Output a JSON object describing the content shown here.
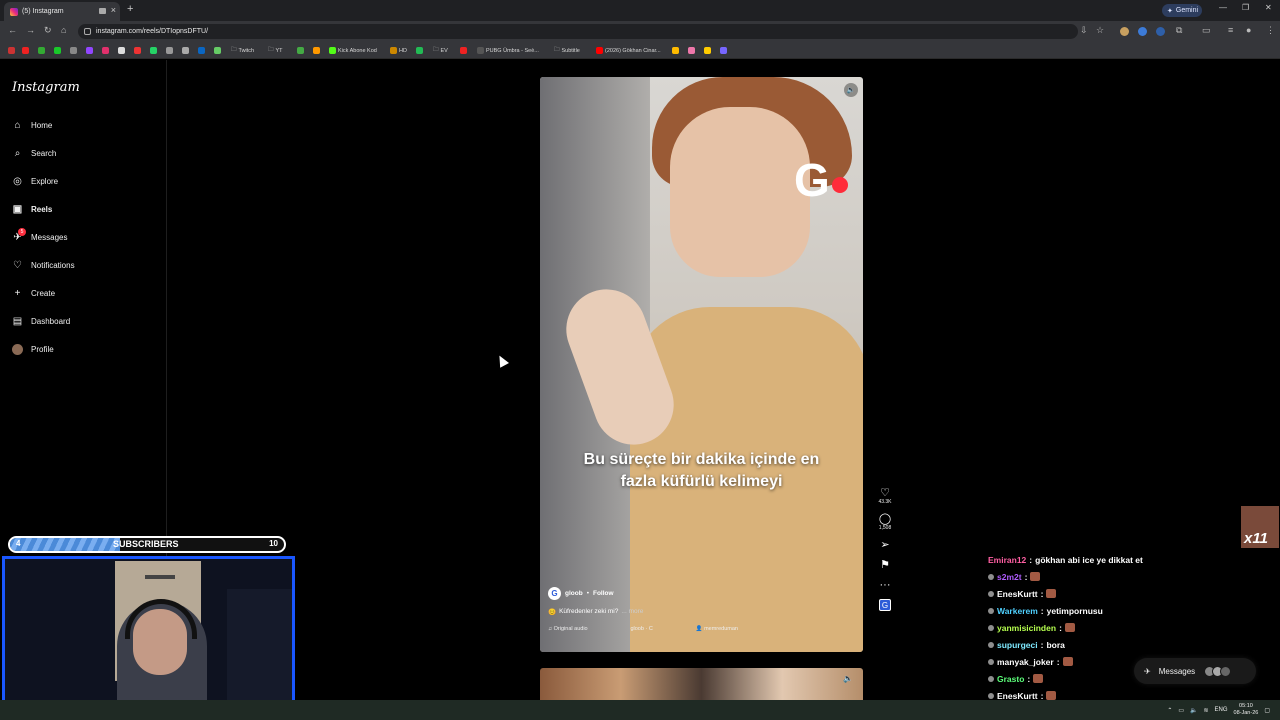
{
  "browser": {
    "tab_title": "(5) Instagram",
    "new_tab": "+",
    "gemini_label": "Gemini",
    "url": "instagram.com/reels/DTIopnsDFTU/",
    "bookmarks": [
      "Twitch",
      "YT",
      "Kick Abone Kod",
      "HD",
      "EV",
      "PUBG Ümbra - Seè...",
      "Subtitle",
      "(2026) Gökhan Cinar..."
    ]
  },
  "instagram": {
    "logo": "Instagram",
    "nav": [
      {
        "label": "Home",
        "icon": "home-icon"
      },
      {
        "label": "Search",
        "icon": "search-icon"
      },
      {
        "label": "Explore",
        "icon": "compass-icon"
      },
      {
        "label": "Reels",
        "icon": "reels-icon",
        "active": true
      },
      {
        "label": "Messages",
        "icon": "messenger-icon",
        "badge": "5"
      },
      {
        "label": "Notifications",
        "icon": "heart-icon"
      },
      {
        "label": "Create",
        "icon": "plus-icon"
      },
      {
        "label": "Dashboard",
        "icon": "dashboard-icon"
      },
      {
        "label": "Profile",
        "icon": "avatar-icon"
      }
    ],
    "reel": {
      "brand_letter": "G",
      "caption_line1": "Bu süreçte bir dakika içinde en",
      "caption_line2": "fazla küfürlü kelimeyi",
      "author": "gloob",
      "follow": "Follow",
      "description": "Küfredenler zeki mi?",
      "more": "... more",
      "audio": "Original audio",
      "audio_source": "gloob · C",
      "tagged_user": "memreduman"
    },
    "actions": {
      "likes": "43.3K",
      "comments": "1,508"
    },
    "messages_label": "Messages"
  },
  "stream": {
    "subs_current": "4",
    "subs_label": "SUBSCRIBERS",
    "subs_goal": "10",
    "subs_progress": 0.4,
    "alert_text": "x11",
    "chat": [
      {
        "user": "Emiran12",
        "color": "#ff5fa3",
        "msg": "gökhan abi ice ye dikkat et",
        "emote": false
      },
      {
        "user": "s2m2t",
        "color": "#b05cff",
        "msg": "",
        "emote": true
      },
      {
        "user": "EnesKurtt",
        "color": "#ffffff",
        "msg": "",
        "emote": true
      },
      {
        "user": "Warkerem",
        "color": "#4fd1ff",
        "msg": "yetimpornusu",
        "emote": false
      },
      {
        "user": "yanmisicinden",
        "color": "#b6ff4f",
        "msg": "",
        "emote": true
      },
      {
        "user": "supurgeci",
        "color": "#7ee9ff",
        "msg": "bora",
        "emote": false
      },
      {
        "user": "manyak_joker",
        "color": "#ffffff",
        "msg": "",
        "emote": true
      },
      {
        "user": "Grasto",
        "color": "#5cff7a",
        "msg": "",
        "emote": true
      },
      {
        "user": "EnesKurtt",
        "color": "#ffffff",
        "msg": "",
        "emote": true
      }
    ]
  },
  "taskbar": {
    "lang": "ENG",
    "time": "05:10",
    "date": "08-Jan-26"
  }
}
